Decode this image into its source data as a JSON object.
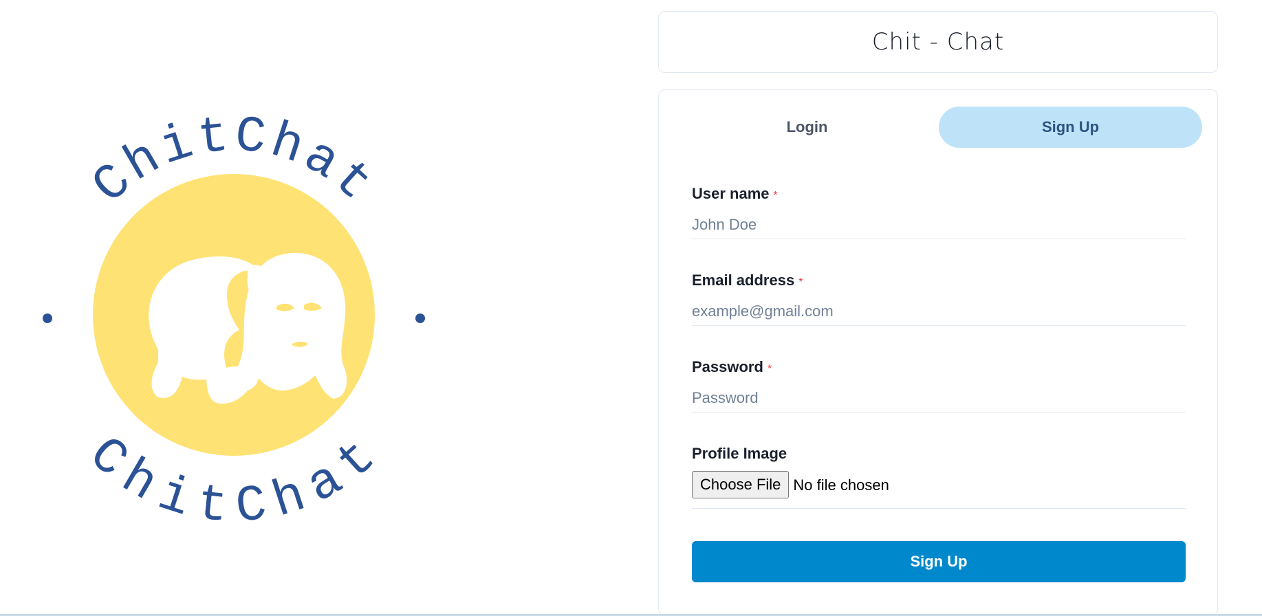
{
  "logo": {
    "top_text": "ChitChat",
    "bottom_text": "ChitChat",
    "colors": {
      "text": "#2c5296",
      "circle": "#ffe274",
      "figures": "#ffffff"
    }
  },
  "header": {
    "title": "Chit - Chat"
  },
  "tabs": [
    {
      "label": "Login",
      "active": false
    },
    {
      "label": "Sign Up",
      "active": true
    }
  ],
  "form": {
    "username": {
      "label": "User name",
      "required_mark": "*",
      "placeholder": "John Doe",
      "value": ""
    },
    "email": {
      "label": "Email address",
      "required_mark": "*",
      "placeholder": "example@gmail.com",
      "value": ""
    },
    "password": {
      "label": "Password",
      "required_mark": "*",
      "placeholder": "Password",
      "value": ""
    },
    "profile_image": {
      "label": "Profile Image",
      "button_label": "Choose File",
      "status": "No file chosen"
    },
    "submit_label": "Sign Up"
  },
  "colors": {
    "tab_active_bg": "#bee3f8",
    "tab_active_text": "#2c5282",
    "primary_button": "#0088cc",
    "required": "#e53e3e"
  }
}
